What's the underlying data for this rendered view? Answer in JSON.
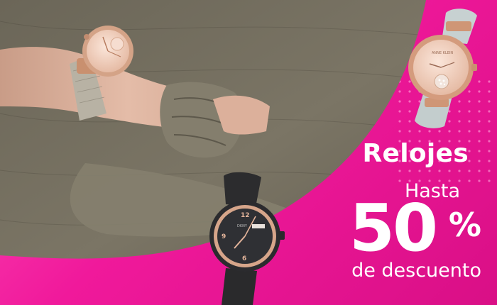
{
  "promo": {
    "category": "Relojes",
    "lead_in": "Hasta",
    "discount_number": "50",
    "discount_symbol": "%",
    "discount_suffix": "de descuento"
  },
  "colors": {
    "brand_pink": "#f0199b",
    "pink_light": "#ff4fb8",
    "pink_dark": "#d90f86",
    "text": "#ffffff",
    "sweater": "#6f6a5b",
    "rose_gold": "#d9a48a"
  },
  "watches": [
    {
      "icon": "rose-gold-watch-icon",
      "brand": "ANNE KLEIN",
      "strap": "light gray leather"
    },
    {
      "icon": "black-watch-icon",
      "brand": "DKNY",
      "strap": "black silicone"
    },
    {
      "icon": "mesh-watch-icon",
      "strap": "silver mesh"
    }
  ]
}
